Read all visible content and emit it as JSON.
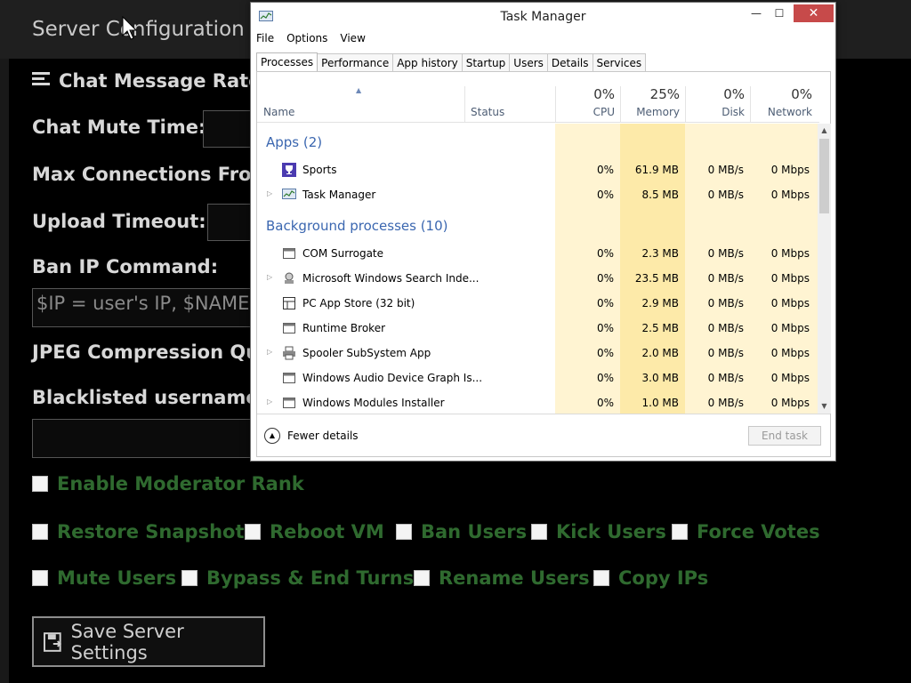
{
  "server": {
    "title": "Server Configuration",
    "labels": {
      "chat_rate": "Chat Message Rate",
      "mute_time": "Chat Mute Time:",
      "max_conn": "Max Connections From",
      "upload_timeout": "Upload Timeout:",
      "ban_cmd": "Ban IP Command:",
      "jpeg": "JPEG Compression Qu",
      "blacklist": "Blacklisted usernames"
    },
    "ban_cmd_placeholder": "$IP = user's IP, $NAME",
    "checks": {
      "moderator": "Enable Moderator Rank",
      "restore": "Restore Snapshot",
      "reboot": "Reboot VM",
      "ban": "Ban Users",
      "kick": "Kick Users",
      "force": "Force Votes",
      "mute": "Mute Users",
      "bypass": "Bypass & End Turns",
      "rename": "Rename Users",
      "copy": "Copy IPs"
    },
    "save_label": "Save Server Settings"
  },
  "taskmanager": {
    "title": "Task Manager",
    "menu": [
      "File",
      "Options",
      "View"
    ],
    "tabs": [
      "Processes",
      "Performance",
      "App history",
      "Startup",
      "Users",
      "Details",
      "Services"
    ],
    "columns": {
      "name": "Name",
      "status": "Status",
      "cpu": {
        "pct": "0%",
        "label": "CPU"
      },
      "memory": {
        "pct": "25%",
        "label": "Memory"
      },
      "disk": {
        "pct": "0%",
        "label": "Disk"
      },
      "network": {
        "pct": "0%",
        "label": "Network"
      }
    },
    "groups": {
      "apps": "Apps (2)",
      "background": "Background processes (10)"
    },
    "apps": [
      {
        "name": "Sports",
        "cpu": "0%",
        "mem": "61.9 MB",
        "disk": "0 MB/s",
        "net": "0 Mbps"
      },
      {
        "name": "Task Manager",
        "cpu": "0%",
        "mem": "8.5 MB",
        "disk": "0 MB/s",
        "net": "0 Mbps"
      }
    ],
    "background": [
      {
        "name": "COM Surrogate",
        "cpu": "0%",
        "mem": "2.3 MB",
        "disk": "0 MB/s",
        "net": "0 Mbps"
      },
      {
        "name": "Microsoft Windows Search Inde...",
        "cpu": "0%",
        "mem": "23.5 MB",
        "disk": "0 MB/s",
        "net": "0 Mbps"
      },
      {
        "name": "PC App Store (32 bit)",
        "cpu": "0%",
        "mem": "2.9 MB",
        "disk": "0 MB/s",
        "net": "0 Mbps"
      },
      {
        "name": "Runtime Broker",
        "cpu": "0%",
        "mem": "2.5 MB",
        "disk": "0 MB/s",
        "net": "0 Mbps"
      },
      {
        "name": "Spooler SubSystem App",
        "cpu": "0%",
        "mem": "2.0 MB",
        "disk": "0 MB/s",
        "net": "0 Mbps"
      },
      {
        "name": "Windows Audio Device Graph Is...",
        "cpu": "0%",
        "mem": "3.0 MB",
        "disk": "0 MB/s",
        "net": "0 Mbps"
      },
      {
        "name": "Windows Modules Installer",
        "cpu": "0%",
        "mem": "1.0 MB",
        "disk": "0 MB/s",
        "net": "0 Mbps"
      }
    ],
    "fewer_details": "Fewer details",
    "end_task": "End task",
    "colors": {
      "heat_light": "#fff4d2",
      "heat_mem": "#fdeaa9",
      "group_text": "#3b67b0"
    }
  }
}
